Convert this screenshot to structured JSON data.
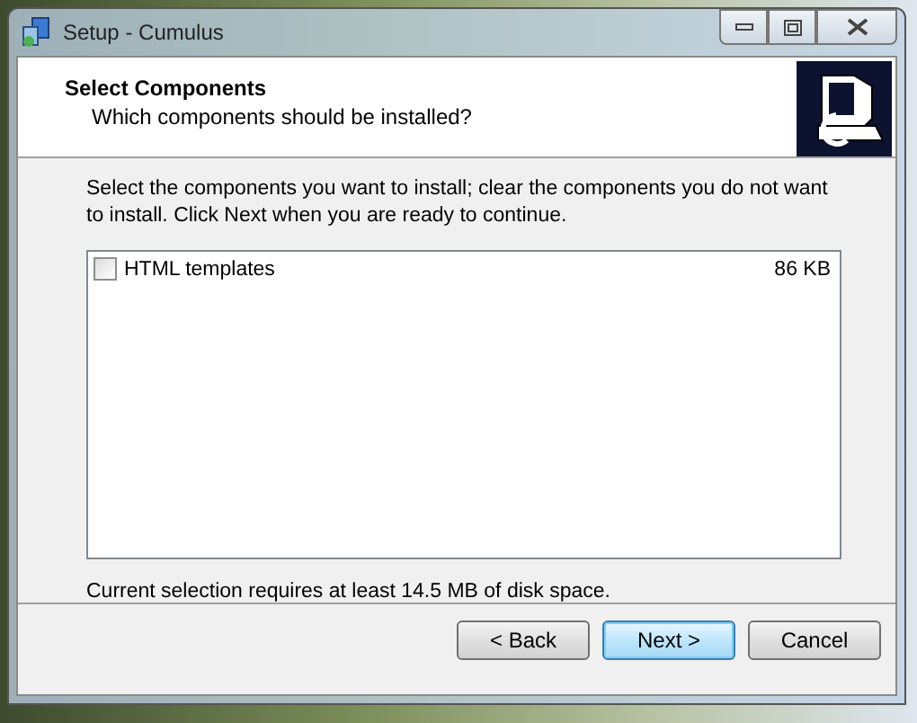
{
  "window": {
    "title": "Setup - Cumulus"
  },
  "header": {
    "title": "Select Components",
    "subtitle": "Which components should be installed?"
  },
  "instructions": "Select the components you want to install; clear the components you do not want to install. Click Next when you are ready to continue.",
  "components": [
    {
      "name": "HTML templates",
      "size": "86 KB",
      "checked": false
    }
  ],
  "disk_space": "Current selection requires at least 14.5 MB of disk space.",
  "buttons": [
    {
      "label": "< Back",
      "default": false
    },
    {
      "label": "Next >",
      "default": true
    },
    {
      "label": "Cancel",
      "default": false
    }
  ]
}
